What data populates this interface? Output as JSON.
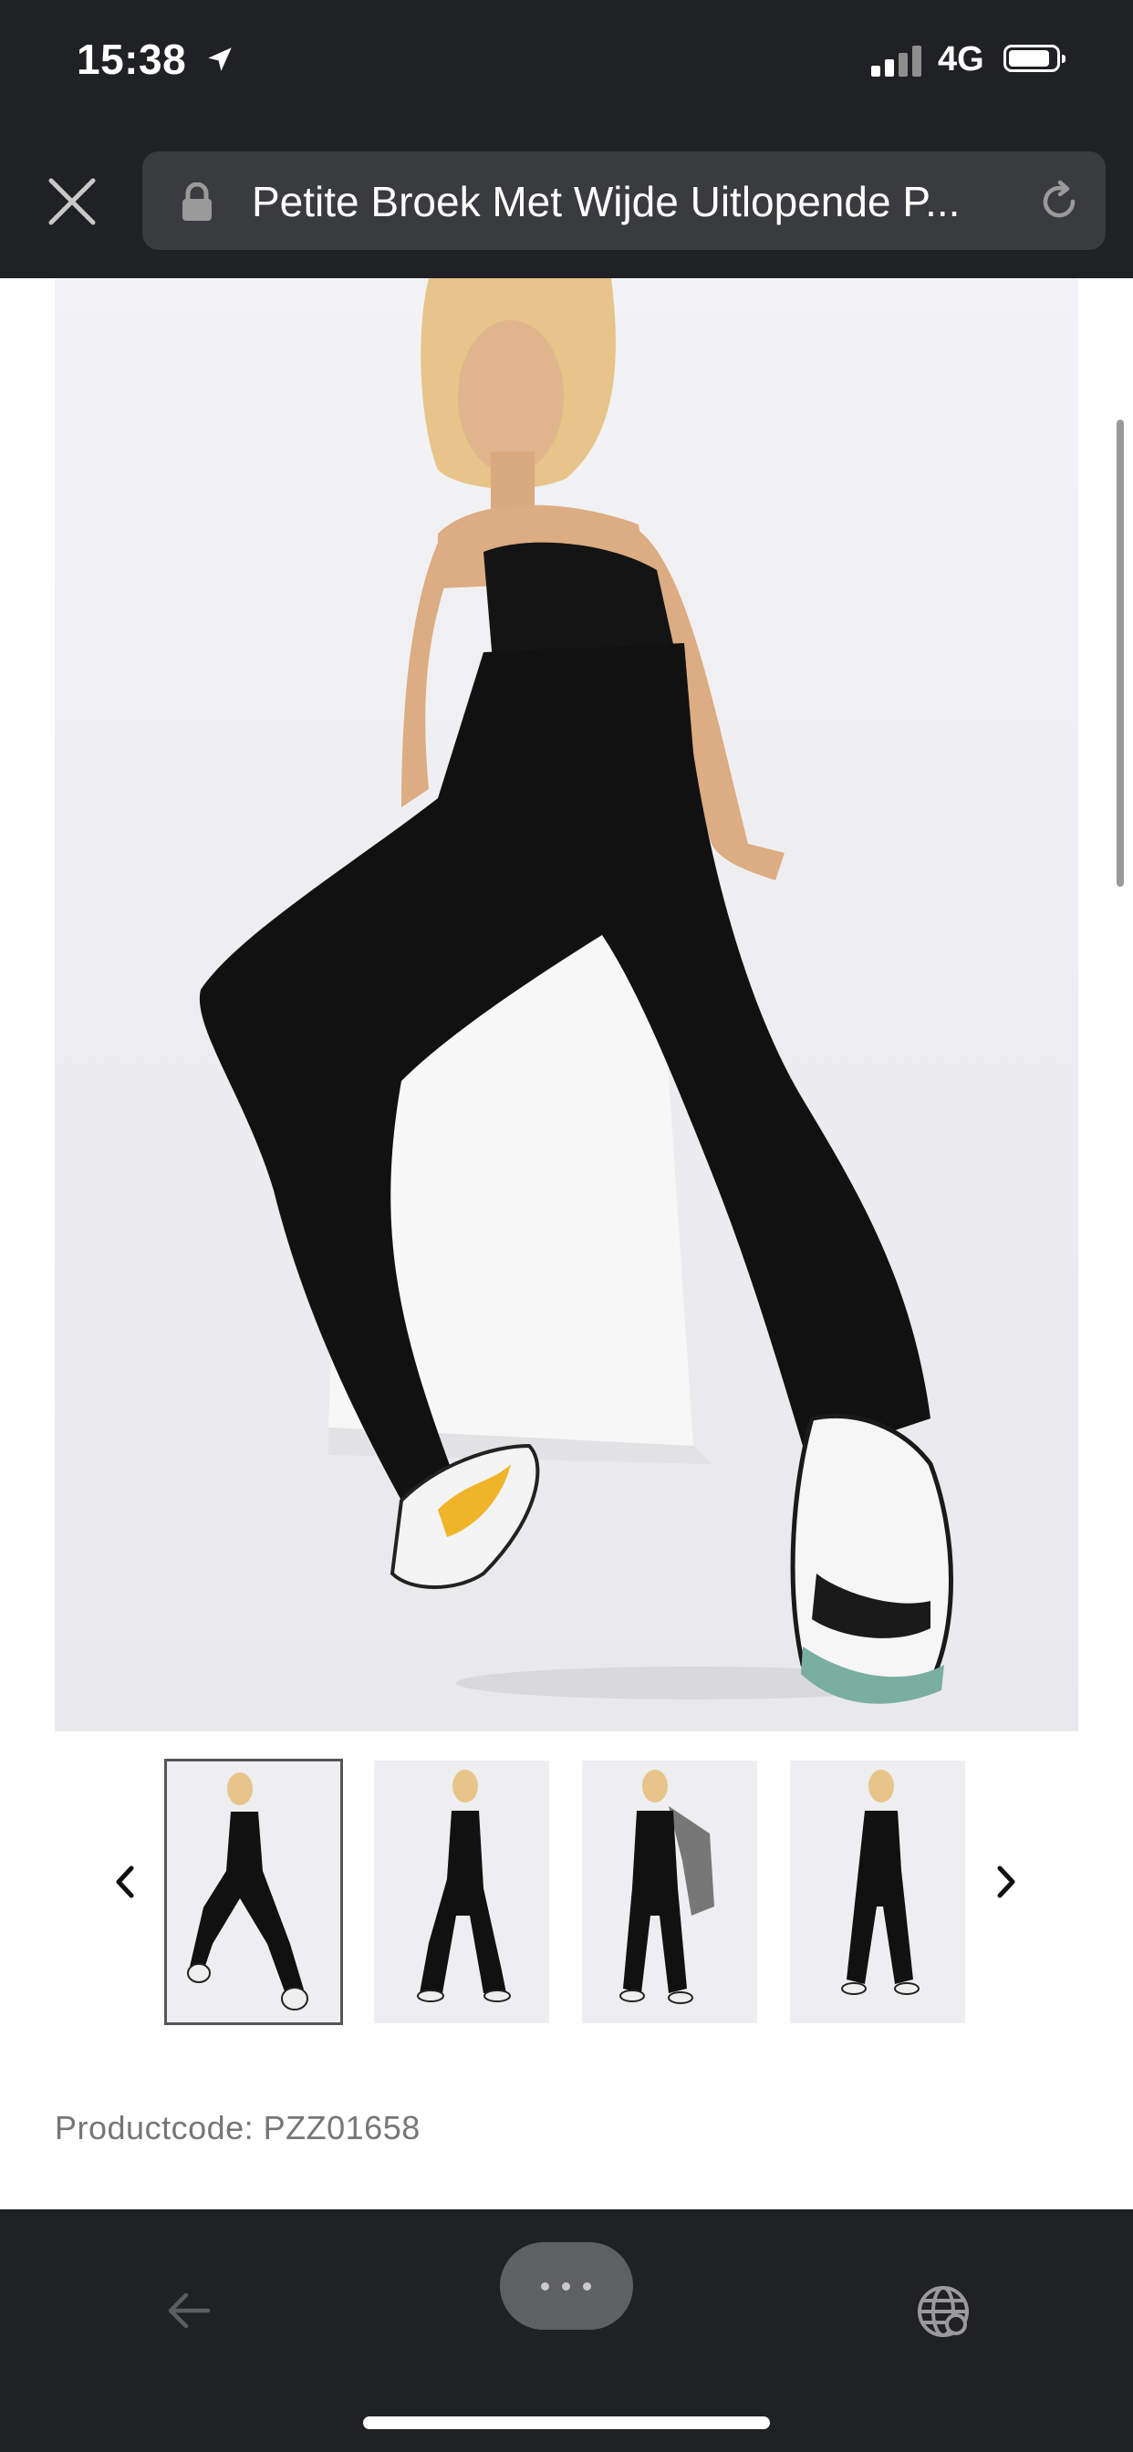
{
  "status_bar": {
    "time": "15:38",
    "network": "4G",
    "location_icon": "location-arrow-icon",
    "signal_icon": "signal-bars-icon",
    "battery_icon": "battery-icon"
  },
  "browser": {
    "close_icon": "close-icon",
    "lock_icon": "lock-icon",
    "page_title": "Petite Broek Met Wijde Uitlopende P...",
    "reload_icon": "reload-icon"
  },
  "product": {
    "main_image": "model wearing black strapless top and black wide-leg split-hem trousers with sneakers",
    "thumbnails": [
      {
        "label": "thumbnail 1",
        "selected": true
      },
      {
        "label": "thumbnail 2",
        "selected": false
      },
      {
        "label": "thumbnail 3",
        "selected": false
      },
      {
        "label": "thumbnail 4",
        "selected": false
      }
    ],
    "prev_icon": "chevron-left-icon",
    "next_icon": "chevron-right-icon",
    "code_label": "Productcode: PZZ01658"
  },
  "toolbar": {
    "back_icon": "arrow-left-icon",
    "menu_icon": "more-dots-icon",
    "translate_icon": "globe-translate-icon"
  },
  "colors": {
    "chrome": "#202124",
    "url_bar": "#3a3b3e",
    "garment": "#111111",
    "sneaker_accent": "#f0b429"
  }
}
